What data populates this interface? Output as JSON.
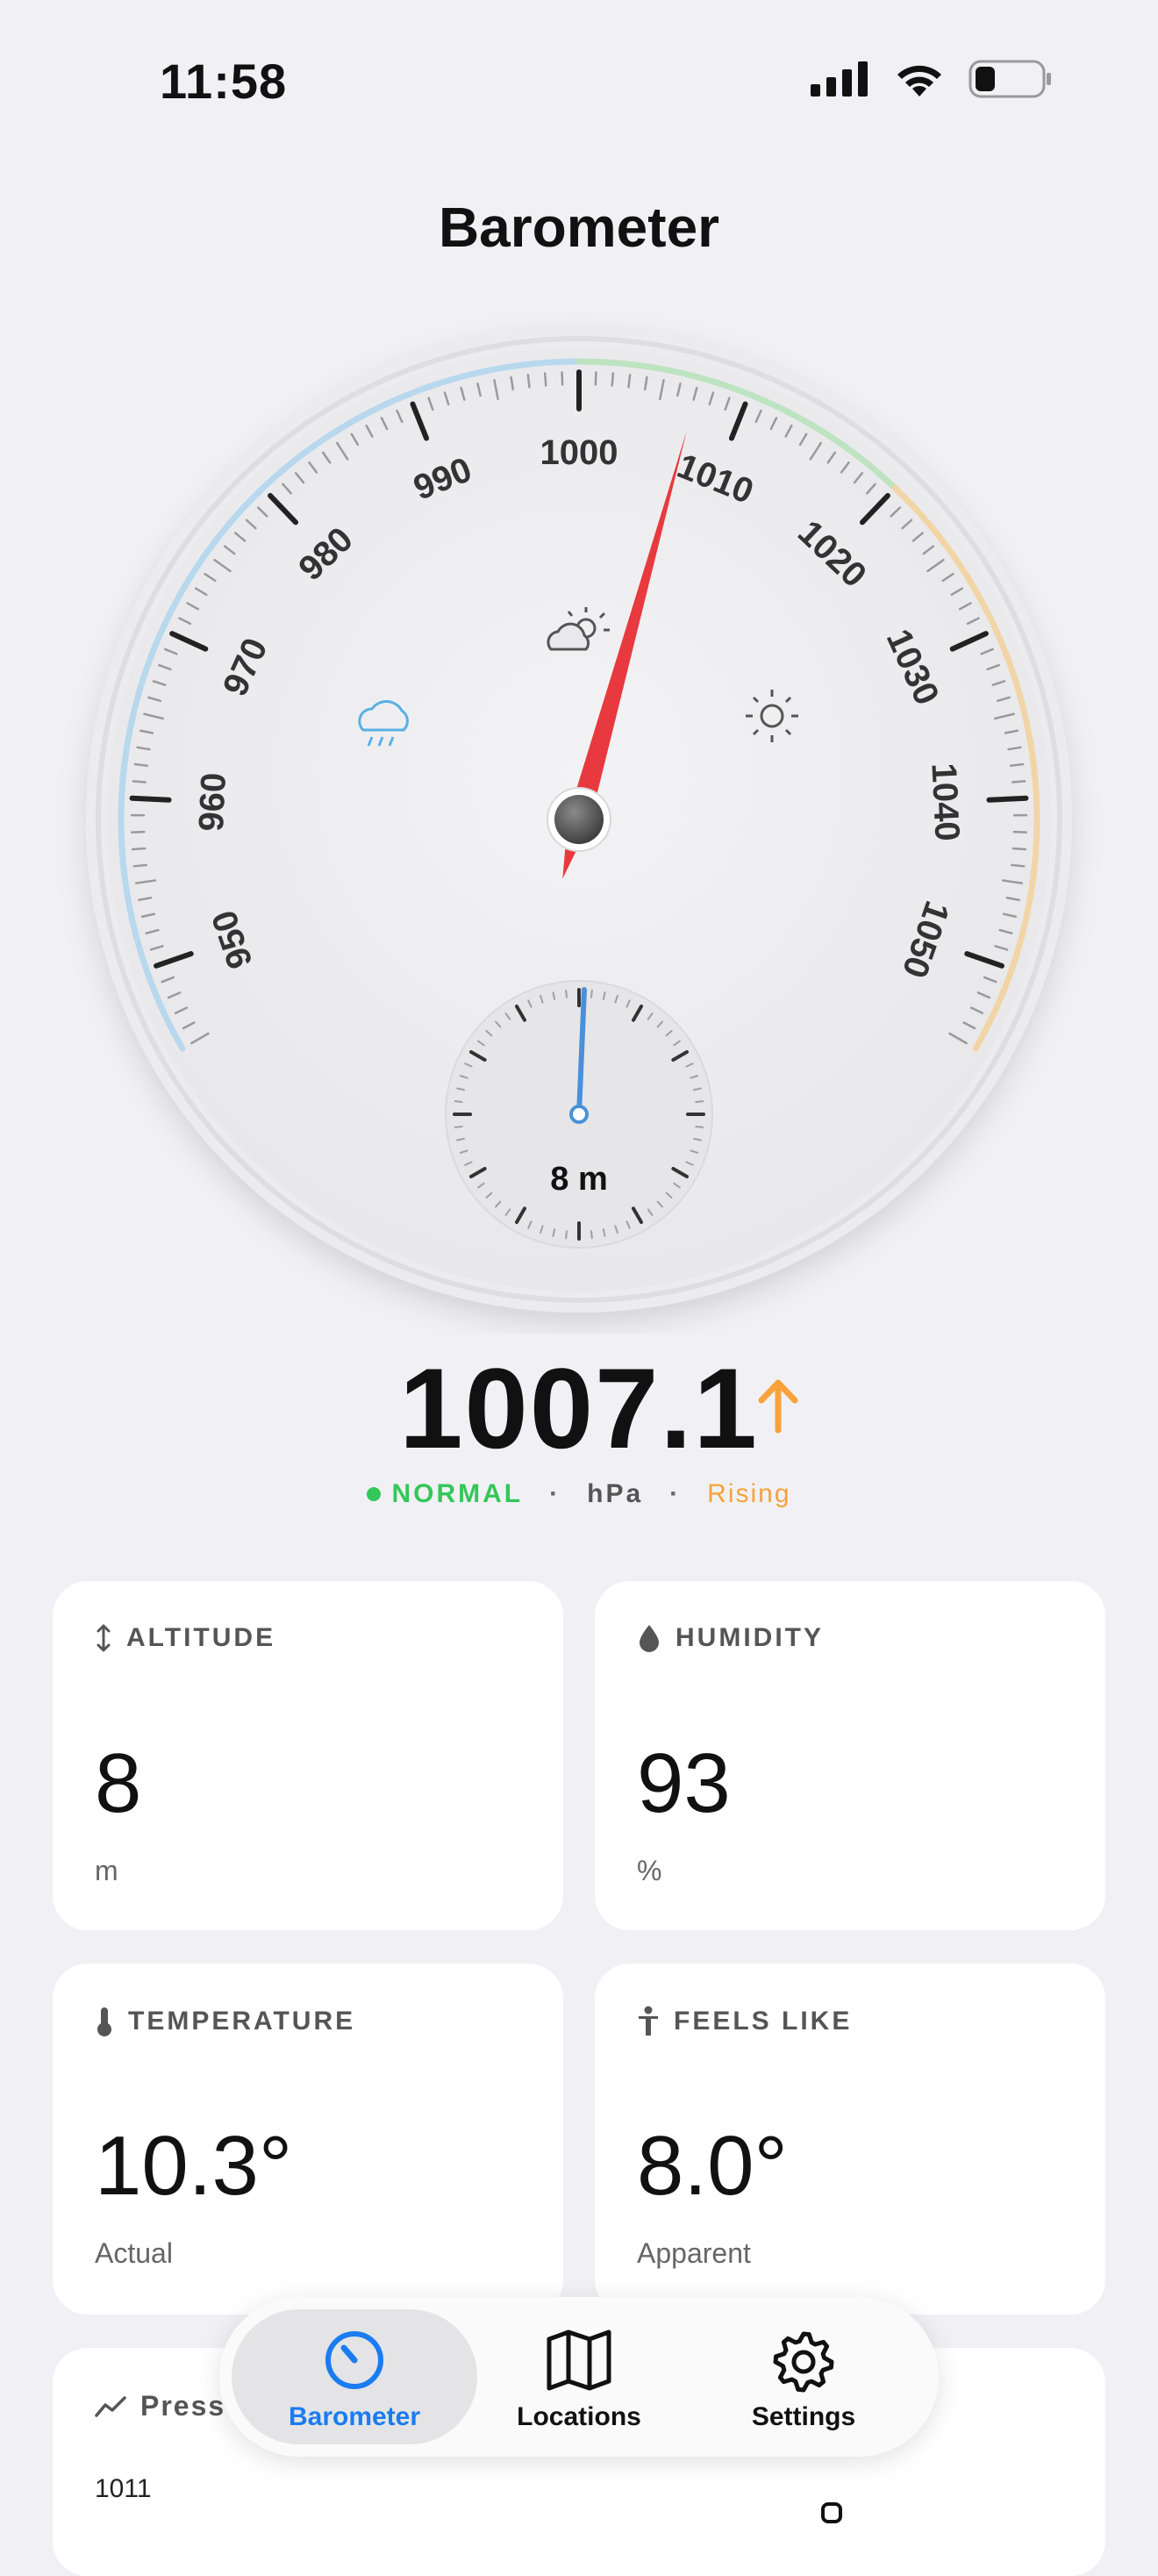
{
  "status_bar": {
    "time": "11:58"
  },
  "title": "Barometer",
  "gauge": {
    "min": 945,
    "max": 1055,
    "labels": [
      "950",
      "960",
      "970",
      "980",
      "990",
      "1000",
      "1010",
      "1020",
      "1030",
      "1040",
      "1050"
    ],
    "needle_value": 1007.1,
    "altitude_dial_label": "8 m",
    "colors": {
      "low": "#b8d8ee",
      "normal": "#bde3c0",
      "high": "#f2d5a7",
      "needle": "#e8393f",
      "altitude_needle": "#4a90d9"
    },
    "icons": [
      "rain-cloud-icon",
      "partly-cloudy-icon",
      "sun-icon"
    ]
  },
  "reading": {
    "value": "1007.1",
    "status": "NORMAL",
    "unit": "hPa",
    "trend": "Rising",
    "trend_color": "#f7a23b"
  },
  "cards": {
    "altitude": {
      "label": "ALTITUDE",
      "value": "8",
      "sub": "m"
    },
    "humidity": {
      "label": "HUMIDITY",
      "value": "93",
      "sub": "%"
    },
    "temperature": {
      "label": "TEMPERATURE",
      "value": "10.3°",
      "sub": "Actual"
    },
    "feels_like": {
      "label": "FEELS LIKE",
      "value": "8.0°",
      "sub": "Apparent"
    },
    "pressure": {
      "label": "Press",
      "value": "1011"
    }
  },
  "tabs": [
    {
      "label": "Barometer",
      "icon": "gauge-icon",
      "active": true
    },
    {
      "label": "Locations",
      "icon": "map-icon",
      "active": false
    },
    {
      "label": "Settings",
      "icon": "gear-icon",
      "active": false
    }
  ],
  "accent": "#1a7cf0"
}
